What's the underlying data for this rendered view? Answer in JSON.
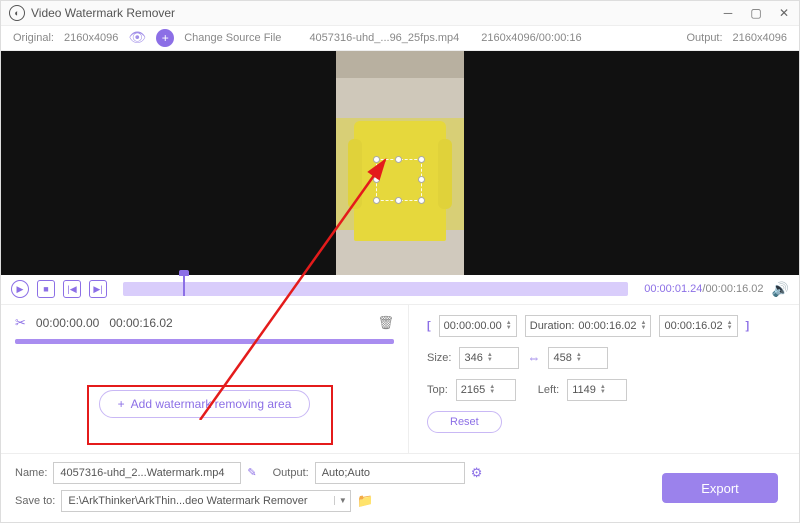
{
  "title": "Video Watermark Remover",
  "info": {
    "original_label": "Original:",
    "original_res": "2160x4096",
    "change_source": "Change Source File",
    "filename": "4057316-uhd_...96_25fps.mp4",
    "res_time": "2160x4096/00:00:16",
    "output_label": "Output:",
    "output_res": "2160x4096"
  },
  "timeline": {
    "current": "00:00:01.24",
    "total": "00:00:16.02"
  },
  "segment": {
    "start": "00:00:00.00",
    "end": "00:00:16.02"
  },
  "range": {
    "start": "00:00:00.00",
    "duration_label": "Duration:",
    "duration": "00:00:16.02",
    "end": "00:00:16.02"
  },
  "size": {
    "label": "Size:",
    "w": "346",
    "h": "458"
  },
  "pos": {
    "top_label": "Top:",
    "top": "2165",
    "left_label": "Left:",
    "left": "1149"
  },
  "buttons": {
    "add_area": "Add watermark removing area",
    "reset": "Reset",
    "export": "Export"
  },
  "bottom": {
    "name_label": "Name:",
    "name_value": "4057316-uhd_2...Watermark.mp4",
    "output_label": "Output:",
    "output_value": "Auto;Auto",
    "save_label": "Save to:",
    "save_value": "E:\\ArkThinker\\ArkThin...deo Watermark Remover"
  }
}
